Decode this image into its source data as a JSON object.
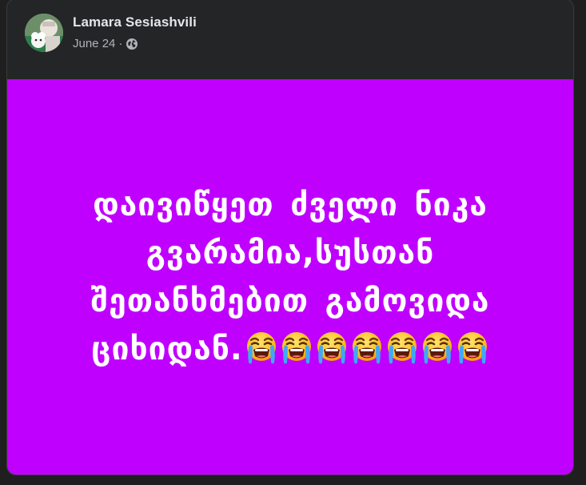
{
  "post": {
    "author_name": "Lamara Sesiashvili",
    "date": "June 24",
    "separator": "·",
    "privacy_icon": "globe-icon",
    "avatar_icon": "avatar",
    "body_text": "დაივიწყეთ ძველი ნიკა გვარამია,სუსთან შეთანხმებით გამოვიდა ციხიდან.",
    "emoji_icon": "loudly-crying-face-icon",
    "emoji_count": 7,
    "colors": {
      "page_background": "#1f1f20",
      "card_background": "#242526",
      "post_background": "#c000ff",
      "post_text": "#ffffff",
      "author_text": "#e4e6eb",
      "meta_text": "#b0b3b8"
    }
  }
}
